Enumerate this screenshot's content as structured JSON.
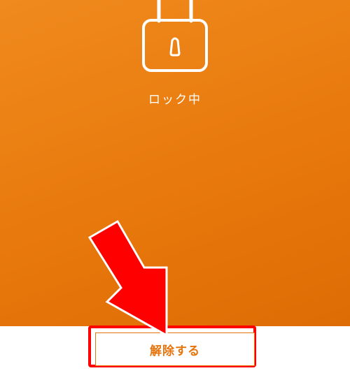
{
  "lock_screen": {
    "status_label": "ロック中",
    "background_color": "#e8790c",
    "icon": "padlock-icon"
  },
  "unlock": {
    "button_label": "解除する",
    "accent_color": "#e6740c"
  },
  "annotation": {
    "arrow_color": "#ff0000",
    "icon": "pointer-arrow-icon"
  }
}
